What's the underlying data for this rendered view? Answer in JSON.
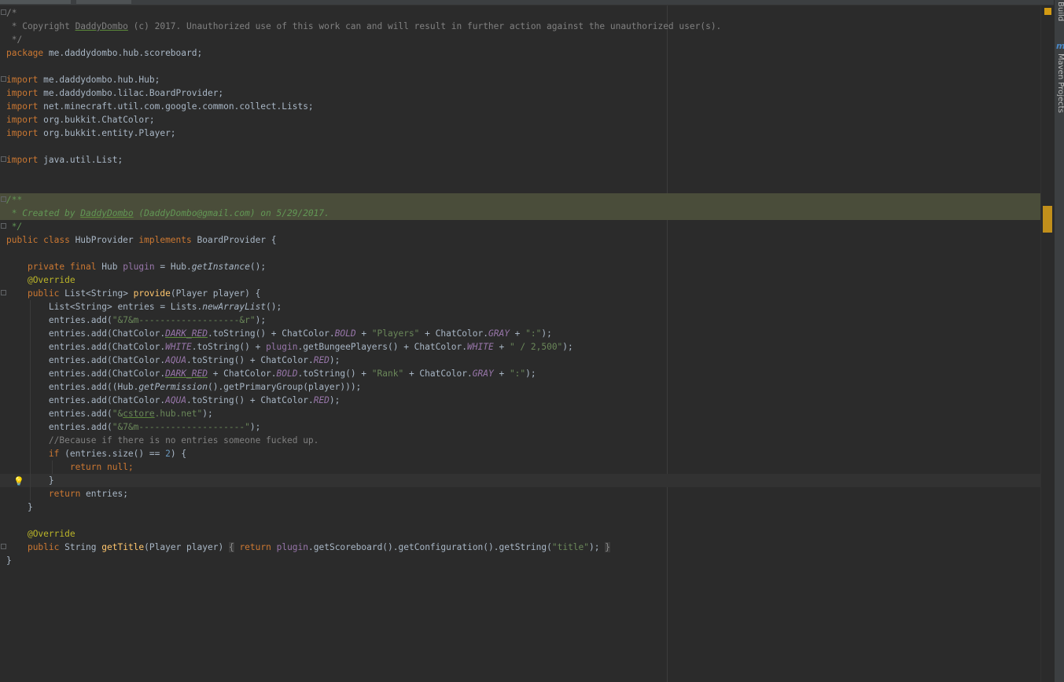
{
  "tool_windows": {
    "build": "Build",
    "maven": "Maven Projects"
  },
  "code": {
    "l1": "/*",
    "l2": " * Copyright DaddyDombo (c) 2017. Unauthorized use of this work can and will result in further action against the unauthorized user(s).",
    "l3": " */",
    "pkg_kw": "package",
    "pkg_name": " me.daddydombo.hub.scoreboard;",
    "import_kw": "import",
    "imp1": " me.daddydombo.hub.Hub;",
    "imp2": " me.daddydombo.lilac.BoardProvider;",
    "imp3": " net.minecraft.util.com.google.common.collect.Lists;",
    "imp4": " org.bukkit.ChatColor;",
    "imp5": " org.bukkit.entity.Player;",
    "imp6": " java.util.List;",
    "doc1": "/**",
    "doc2": " * Created by DaddyDombo (DaddyDombo@gmail.com) on 5/29/2017.",
    "doc3": " */",
    "class_decl_kw": "public class",
    "class_name": " HubProvider ",
    "implements_kw": "implements",
    "class_tail": " BoardProvider {",
    "field_kw": "private final",
    "field_type": " Hub ",
    "field_name": "plugin",
    "field_eq": " = Hub.",
    "field_call": "getInstance",
    "field_tail": "();",
    "override": "@Override",
    "pub_kw": "public",
    "provide_type": " List<String> ",
    "provide_name": "provide",
    "provide_params": "(Player player) {",
    "entries_decl_a": "List<String> entries = Lists.",
    "entries_decl_call": "newArrayList",
    "entries_decl_tail": "();",
    "e1_pre": "entries.add(",
    "e1_str": "\"&7&m-------------------&r\"",
    "e1_post": ");",
    "e2_pre": "entries.add(ChatColor.",
    "e2_f1": "DARK_RED",
    "e2_mid1": ".toString() + ChatColor.",
    "e2_f2": "BOLD",
    "e2_mid2": " + ",
    "e2_str1": "\"Players\"",
    "e2_mid3": " + ChatColor.",
    "e2_f3": "GRAY",
    "e2_mid4": " + ",
    "e2_str2": "\":\"",
    "e2_post": ");",
    "e3_pre": "entries.add(ChatColor.",
    "e3_f1": "WHITE",
    "e3_mid1": ".toString() + ",
    "e3_field": "plugin",
    "e3_mid2": ".getBungeePlayers() + ChatColor.",
    "e3_f2": "WHITE",
    "e3_mid3": " + ",
    "e3_str": "\" / 2,500\"",
    "e3_post": ");",
    "e4_pre": "entries.add(ChatColor.",
    "e4_f1": "AQUA",
    "e4_mid": ".toString() + ChatColor.",
    "e4_f2": "RED",
    "e4_post": ");",
    "e5_pre": "entries.add(ChatColor.",
    "e5_f1": "DARK_RED",
    "e5_mid1": " + ChatColor.",
    "e5_f2": "BOLD",
    "e5_mid2": ".toString() + ",
    "e5_str1": "\"Rank\"",
    "e5_mid3": " + ChatColor.",
    "e5_f3": "GRAY",
    "e5_mid4": " + ",
    "e5_str2": "\":\"",
    "e5_post": ");",
    "e6_pre": "entries.add((Hub.",
    "e6_call": "getPermission",
    "e6_post": "().getPrimaryGroup(player)));",
    "e7_pre": "entries.add(ChatColor.",
    "e7_f1": "AQUA",
    "e7_mid": ".toString() + ChatColor.",
    "e7_f2": "RED",
    "e7_post": ");",
    "e8_pre": "entries.add(",
    "e8_str": "\"&cstore.hub.net\"",
    "e8_post": ");",
    "e9_pre": "entries.add(",
    "e9_str": "\"&7&m--------------------\"",
    "e9_post": ");",
    "comment": "//Because if there is no entries someone fucked up.",
    "if_kw": "if",
    "if_mid": " (entries.size() == ",
    "if_num": "2",
    "if_tail": ") {",
    "return_kw": "return",
    "null_kw": " null",
    "semi": ";",
    "close_brace": "}",
    "return_entries": " entries;",
    "title_type": " String ",
    "title_name": "getTitle",
    "title_params": "(Player player) ",
    "fold_open": "{",
    "title_ret": "return",
    "title_field": " plugin",
    "title_call": ".getScoreboard().getConfiguration().getString(",
    "title_str": "\"title\"",
    "title_end": ");",
    "fold_close": "}"
  }
}
